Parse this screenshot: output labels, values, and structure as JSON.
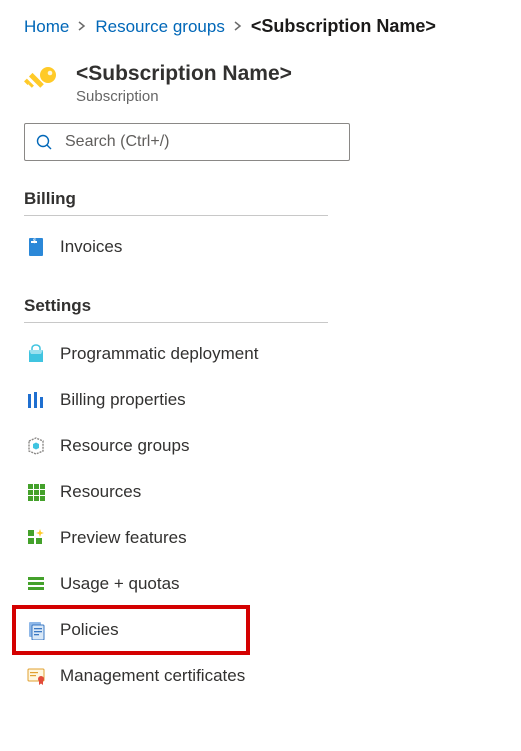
{
  "breadcrumb": {
    "home": "Home",
    "resource_groups": "Resource groups",
    "current": "<Subscription Name>"
  },
  "header": {
    "title": "<Subscription Name>",
    "subtitle": "Subscription"
  },
  "search": {
    "placeholder": "Search (Ctrl+/)"
  },
  "sections": {
    "billing": {
      "title": "Billing",
      "items": [
        {
          "label": "Invoices"
        }
      ]
    },
    "settings": {
      "title": "Settings",
      "items": [
        {
          "label": "Programmatic deployment"
        },
        {
          "label": "Billing properties"
        },
        {
          "label": "Resource groups"
        },
        {
          "label": "Resources"
        },
        {
          "label": "Preview features"
        },
        {
          "label": "Usage + quotas"
        },
        {
          "label": "Policies"
        },
        {
          "label": "Management certificates"
        }
      ]
    }
  },
  "colors": {
    "link": "#0067b8",
    "highlight": "#d40000",
    "key_icon": "#ffca28"
  }
}
